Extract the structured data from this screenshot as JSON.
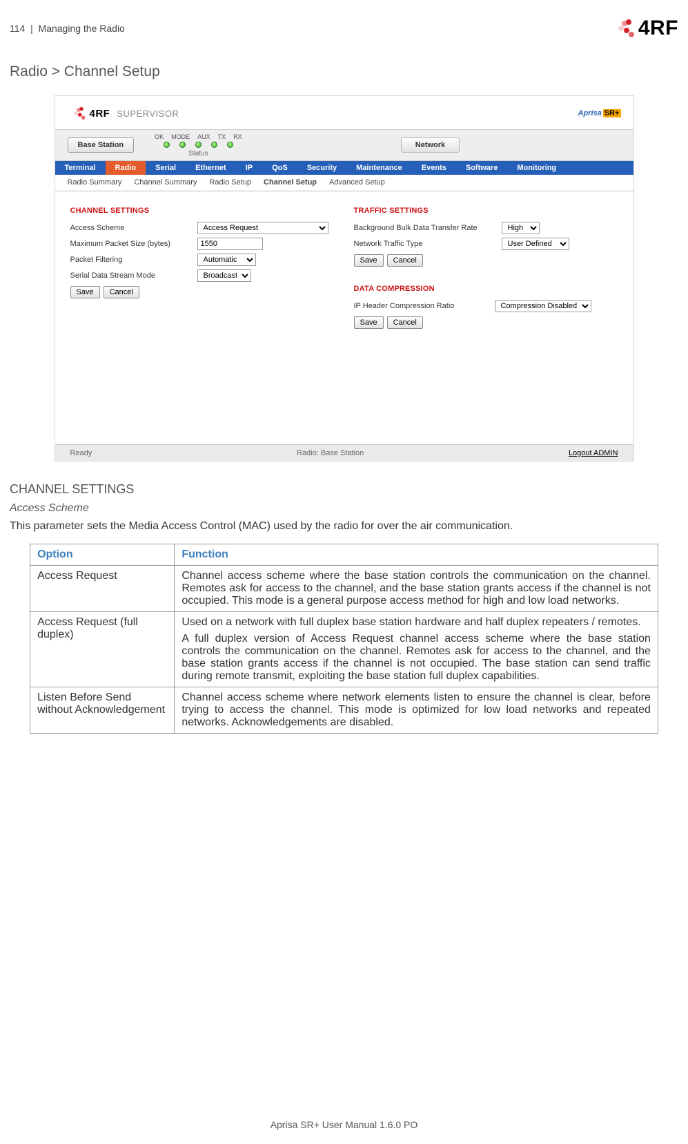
{
  "header": {
    "page_num": "114",
    "section": "Managing the Radio",
    "brand": "4RF"
  },
  "page_title": "Radio > Channel Setup",
  "supervisor": {
    "title": "SUPERVISOR",
    "aprisa": "Aprisa",
    "aprisa_suffix": "SR+",
    "station": "Base Station",
    "led_labels": [
      "OK",
      "MODE",
      "AUX",
      "TX",
      "RX"
    ],
    "status_label": "Status",
    "network": "Network",
    "tabs": [
      "Terminal",
      "Radio",
      "Serial",
      "Ethernet",
      "IP",
      "QoS",
      "Security",
      "Maintenance",
      "Events",
      "Software",
      "Monitoring"
    ],
    "active_tab": "Radio",
    "subtabs": [
      "Radio Summary",
      "Channel Summary",
      "Radio Setup",
      "Channel Setup",
      "Advanced Setup"
    ],
    "active_subtab": "Channel Setup",
    "channel_settings": {
      "title": "CHANNEL SETTINGS",
      "access_scheme_lbl": "Access Scheme",
      "access_scheme_val": "Access Request",
      "max_packet_lbl": "Maximum Packet Size (bytes)",
      "max_packet_val": "1550",
      "packet_filtering_lbl": "Packet Filtering",
      "packet_filtering_val": "Automatic",
      "serial_mode_lbl": "Serial Data Stream Mode",
      "serial_mode_val": "Broadcast"
    },
    "traffic_settings": {
      "title": "TRAFFIC SETTINGS",
      "bg_rate_lbl": "Background Bulk Data Transfer Rate",
      "bg_rate_val": "High",
      "net_type_lbl": "Network Traffic Type",
      "net_type_val": "User Defined"
    },
    "data_compression": {
      "title": "DATA COMPRESSION",
      "ip_hdr_lbl": "IP Header Compression Ratio",
      "ip_hdr_val": "Compression Disabled"
    },
    "save": "Save",
    "cancel": "Cancel",
    "footer": {
      "ready": "Ready",
      "radio": "Radio: Base Station",
      "logout": "Logout ADMIN"
    }
  },
  "channel_section": {
    "heading": "CHANNEL SETTINGS",
    "subheading": "Access Scheme",
    "intro": "This parameter sets the Media Access Control (MAC) used by the radio for over the air communication.",
    "th_option": "Option",
    "th_function": "Function",
    "rows": [
      {
        "opt": "Access Request",
        "fun": "Channel access scheme where the base station controls the communication on the channel. Remotes ask for access to the channel, and the base station grants access if the channel is not occupied. This mode is a general purpose access method for high and low load networks."
      },
      {
        "opt": "Access Request (full duplex)",
        "fun": "Used on a network with full duplex base station hardware and half duplex repeaters / remotes.",
        "fun2": "A full duplex version of Access Request channel access scheme where the base station controls the communication on the channel. Remotes ask for access to the channel, and the base station grants access if the channel is not occupied. The base station can send traffic during remote transmit, exploiting the base station full duplex capabilities."
      },
      {
        "opt": "Listen Before Send without Acknowledgement",
        "fun": "Channel access scheme where network elements listen to ensure the channel is clear, before trying to access the channel. This mode is optimized for low load networks and repeated networks. Acknowledgements are disabled."
      }
    ]
  },
  "footer_text": "Aprisa SR+ User Manual 1.6.0 PO"
}
